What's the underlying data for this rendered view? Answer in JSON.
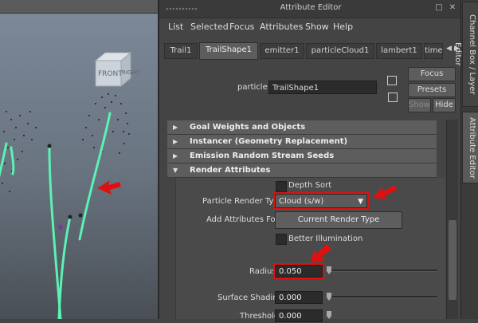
{
  "viewport": {
    "viewcube": {
      "front": "FRONT",
      "right": "RIGHT"
    }
  },
  "window": {
    "title": "Attribute Editor",
    "menu": [
      "List",
      "Selected",
      "Focus",
      "Attributes",
      "Show",
      "Help"
    ]
  },
  "tabs": [
    "Trail1",
    "TrailShape1",
    "emitter1",
    "particleCloud1",
    "lambert1",
    "time"
  ],
  "node": {
    "label": "particle:",
    "value": "TrailShape1",
    "buttons": {
      "focus": "Focus",
      "presets": "Presets",
      "show": "Show",
      "hide": "Hide"
    }
  },
  "sections": [
    {
      "label": "Goal Weights and Objects",
      "expanded": false
    },
    {
      "label": "Instancer (Geometry Replacement)",
      "expanded": false
    },
    {
      "label": "Emission Random Stream Seeds",
      "expanded": false
    },
    {
      "label": "Render Attributes",
      "expanded": true
    }
  ],
  "render": {
    "depth_sort": "Depth Sort",
    "prt_label": "Particle Render Type",
    "prt_value": "Cloud (s/w)",
    "add_attr_label": "Add Attributes For",
    "add_attr_button": "Current Render Type",
    "better_illum": "Better Illumination",
    "radius_label": "Radius",
    "radius_value": "0.050",
    "surface_label": "Surface Shading",
    "surface_value": "0.000",
    "threshold_label": "Threshold",
    "threshold_value": "0.000"
  },
  "side_tabs": {
    "channel_box": "Channel Box / Layer Editor",
    "attr_editor": "Attribute Editor"
  },
  "colors": {
    "highlight": "#e01010",
    "trail": "#5cf2b4",
    "panel": "#444444"
  }
}
